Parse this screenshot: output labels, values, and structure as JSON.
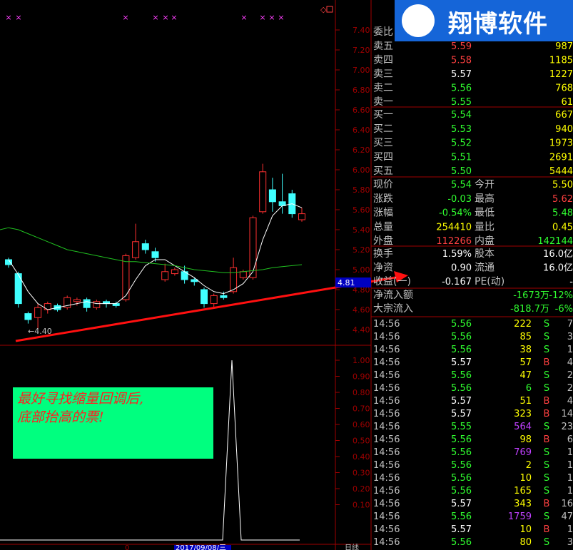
{
  "logo": {
    "text": "翔博软件"
  },
  "annotation": {
    "line1": "最好寻找缩量回调后,",
    "line2": "底部抬高的票!"
  },
  "price_axis": [
    "7.40",
    "7.20",
    "7.00",
    "6.80",
    "6.60",
    "6.40",
    "6.20",
    "6.00",
    "5.80",
    "5.60",
    "5.40",
    "5.20",
    "5.00",
    "4.80",
    "4.60",
    "4.40"
  ],
  "indicator_axis": [
    "1.00",
    "0.90",
    "0.80",
    "0.70",
    "0.60",
    "0.50",
    "0.40",
    "0.30",
    "0.20",
    "0.10"
  ],
  "low_label": "4.40",
  "cursor_price": "4.81",
  "bottom_date": "2017/09/08/三",
  "bottom_right_label": "日线",
  "order_book": {
    "ratio_label": "委比",
    "sells": [
      {
        "label": "卖五",
        "price": "5.59",
        "vol": "987"
      },
      {
        "label": "卖四",
        "price": "5.58",
        "vol": "1185"
      },
      {
        "label": "卖三",
        "price": "5.57",
        "vol": "1227"
      },
      {
        "label": "卖二",
        "price": "5.56",
        "vol": "768"
      },
      {
        "label": "卖一",
        "price": "5.55",
        "vol": "61"
      }
    ],
    "buys": [
      {
        "label": "买一",
        "price": "5.54",
        "vol": "667"
      },
      {
        "label": "买二",
        "price": "5.53",
        "vol": "940"
      },
      {
        "label": "买三",
        "price": "5.52",
        "vol": "1973"
      },
      {
        "label": "买四",
        "price": "5.51",
        "vol": "2691"
      },
      {
        "label": "买五",
        "price": "5.50",
        "vol": "5444"
      }
    ]
  },
  "quote": [
    {
      "l1": "现价",
      "v1": "5.54",
      "l2": "今开",
      "v2": "5.50"
    },
    {
      "l1": "涨跌",
      "v1": "-0.03",
      "l2": "最高",
      "v2": "5.62"
    },
    {
      "l1": "涨幅",
      "v1": "-0.54%",
      "l2": "最低",
      "v2": "5.48"
    },
    {
      "l1": "总量",
      "v1": "254410",
      "l2": "量比",
      "v2": "0.45"
    },
    {
      "l1": "外盘",
      "v1": "112266",
      "l2": "内盘",
      "v2": "142144"
    }
  ],
  "fundamentals": [
    {
      "l1": "换手",
      "v1": "1.59%",
      "l2": "股本",
      "v2": "16.0亿"
    },
    {
      "l1": "净资",
      "v1": "0.90",
      "l2": "流通",
      "v2": "16.0亿"
    },
    {
      "l1": "收益(一)",
      "v1": "-0.167",
      "l2": "PE(动)",
      "v2": "-"
    }
  ],
  "flows": [
    {
      "label": "净流入额",
      "v1": "-1673万",
      "v2": "-12%"
    },
    {
      "label": "大宗流入",
      "v1": "-818.7万",
      "v2": "-6%"
    }
  ],
  "ticks": [
    {
      "t": "14:56",
      "p": "5.56",
      "v": "222",
      "s": "S",
      "n": "7"
    },
    {
      "t": "14:56",
      "p": "5.56",
      "v": "85",
      "s": "S",
      "n": "3"
    },
    {
      "t": "14:56",
      "p": "5.56",
      "v": "38",
      "s": "S",
      "n": "1"
    },
    {
      "t": "14:56",
      "p": "5.57",
      "v": "57",
      "s": "B",
      "n": "4"
    },
    {
      "t": "14:56",
      "p": "5.56",
      "v": "47",
      "s": "S",
      "n": "2"
    },
    {
      "t": "14:56",
      "p": "5.56",
      "v": "6",
      "s": "S",
      "n": "2"
    },
    {
      "t": "14:56",
      "p": "5.57",
      "v": "51",
      "s": "B",
      "n": "4"
    },
    {
      "t": "14:56",
      "p": "5.57",
      "v": "323",
      "s": "B",
      "n": "14"
    },
    {
      "t": "14:56",
      "p": "5.55",
      "v": "564",
      "s": "S",
      "n": "23"
    },
    {
      "t": "14:56",
      "p": "5.56",
      "v": "98",
      "s": "B",
      "n": "6"
    },
    {
      "t": "14:56",
      "p": "5.56",
      "v": "769",
      "s": "S",
      "n": "1"
    },
    {
      "t": "14:56",
      "p": "5.56",
      "v": "2",
      "s": "S",
      "n": "1"
    },
    {
      "t": "14:56",
      "p": "5.56",
      "v": "10",
      "s": "S",
      "n": "1"
    },
    {
      "t": "14:56",
      "p": "5.56",
      "v": "165",
      "s": "S",
      "n": "1"
    },
    {
      "t": "14:56",
      "p": "5.57",
      "v": "343",
      "s": "B",
      "n": "16"
    },
    {
      "t": "14:56",
      "p": "5.56",
      "v": "1759",
      "s": "S",
      "n": "47"
    },
    {
      "t": "14:56",
      "p": "5.57",
      "v": "10",
      "s": "B",
      "n": "1"
    },
    {
      "t": "14:56",
      "p": "5.56",
      "v": "80",
      "s": "S",
      "n": "3"
    }
  ],
  "tick_volume_colors": [
    "yellow",
    "yellow",
    "yellow",
    "yellow",
    "yellow",
    "green",
    "yellow",
    "yellow",
    "magenta",
    "yellow",
    "magenta",
    "yellow",
    "yellow",
    "yellow",
    "yellow",
    "magenta",
    "yellow",
    "yellow"
  ],
  "candles": [
    {
      "o": 5.1,
      "c": 5.05,
      "h": 5.12,
      "l": 5.02,
      "up": false
    },
    {
      "o": 4.96,
      "c": 4.66,
      "h": 4.98,
      "l": 4.62,
      "up": false
    },
    {
      "o": 4.56,
      "c": 4.5,
      "h": 4.58,
      "l": 4.46,
      "up": false
    },
    {
      "o": 4.52,
      "c": 4.62,
      "h": 4.66,
      "l": 4.4,
      "up": true
    },
    {
      "o": 4.6,
      "c": 4.66,
      "h": 4.68,
      "l": 4.56,
      "up": true
    },
    {
      "o": 4.64,
      "c": 4.6,
      "h": 4.66,
      "l": 4.58,
      "up": false
    },
    {
      "o": 4.62,
      "c": 4.72,
      "h": 4.74,
      "l": 4.6,
      "up": true
    },
    {
      "o": 4.7,
      "c": 4.68,
      "h": 4.72,
      "l": 4.64,
      "up": true
    },
    {
      "o": 4.7,
      "c": 4.62,
      "h": 4.72,
      "l": 4.58,
      "up": false
    },
    {
      "o": 4.62,
      "c": 4.68,
      "h": 4.7,
      "l": 4.6,
      "up": true
    },
    {
      "o": 4.68,
      "c": 4.66,
      "h": 4.7,
      "l": 4.62,
      "up": false
    },
    {
      "o": 4.66,
      "c": 4.64,
      "h": 4.68,
      "l": 4.62,
      "up": false
    },
    {
      "o": 4.7,
      "c": 5.14,
      "h": 5.16,
      "l": 4.68,
      "up": true
    },
    {
      "o": 5.12,
      "c": 5.28,
      "h": 5.46,
      "l": 5.1,
      "up": true
    },
    {
      "o": 5.26,
      "c": 5.2,
      "h": 5.3,
      "l": 5.16,
      "up": false
    },
    {
      "o": 5.18,
      "c": 5.12,
      "h": 5.22,
      "l": 5.08,
      "up": false
    },
    {
      "o": 4.9,
      "c": 4.98,
      "h": 5.06,
      "l": 4.88,
      "up": true
    },
    {
      "o": 4.96,
      "c": 5.0,
      "h": 5.02,
      "l": 4.94,
      "up": true
    },
    {
      "o": 4.98,
      "c": 4.9,
      "h": 5.04,
      "l": 4.86,
      "up": false
    },
    {
      "o": 4.9,
      "c": 4.88,
      "h": 4.92,
      "l": 4.84,
      "up": false
    },
    {
      "o": 4.8,
      "c": 4.66,
      "h": 4.82,
      "l": 4.62,
      "up": false
    },
    {
      "o": 4.66,
      "c": 4.74,
      "h": 4.76,
      "l": 4.62,
      "up": true
    },
    {
      "o": 4.74,
      "c": 4.72,
      "h": 4.78,
      "l": 4.7,
      "up": false
    },
    {
      "o": 4.78,
      "c": 5.02,
      "h": 5.12,
      "l": 4.76,
      "up": true
    },
    {
      "o": 4.92,
      "c": 4.98,
      "h": 5.0,
      "l": 4.9,
      "up": true
    },
    {
      "o": 4.92,
      "c": 5.52,
      "h": 5.54,
      "l": 4.9,
      "up": true
    },
    {
      "o": 5.58,
      "c": 5.98,
      "h": 6.06,
      "l": 5.56,
      "up": true
    },
    {
      "o": 5.8,
      "c": 5.68,
      "h": 5.92,
      "l": 5.58,
      "up": false
    },
    {
      "o": 5.68,
      "c": 5.64,
      "h": 5.96,
      "l": 5.56,
      "up": false
    },
    {
      "o": 5.76,
      "c": 5.56,
      "h": 5.8,
      "l": 5.52,
      "up": false
    },
    {
      "o": 5.56,
      "c": 5.5,
      "h": 5.62,
      "l": 5.48,
      "up": true
    }
  ],
  "ma_short": [
    5.1,
    4.95,
    4.78,
    4.66,
    4.6,
    4.62,
    4.64,
    4.66,
    4.68,
    4.66,
    4.66,
    4.66,
    4.74,
    4.9,
    5.04,
    5.1,
    5.1,
    5.04,
    4.98,
    4.92,
    4.84,
    4.78,
    4.76,
    4.8,
    4.86,
    4.98,
    5.3,
    5.54,
    5.64,
    5.66,
    5.62
  ],
  "ma_long": [
    5.42,
    5.4,
    5.36,
    5.32,
    5.28,
    5.24,
    5.2,
    5.18,
    5.16,
    5.14,
    5.12,
    5.1,
    5.08,
    5.08,
    5.07,
    5.06,
    5.05,
    5.04,
    5.02,
    5.0,
    4.99,
    4.98,
    4.97,
    4.97,
    4.98,
    4.99,
    5.0,
    5.02,
    5.03,
    5.04,
    5.05
  ],
  "indicator": {
    "spike_value": 1.0
  }
}
